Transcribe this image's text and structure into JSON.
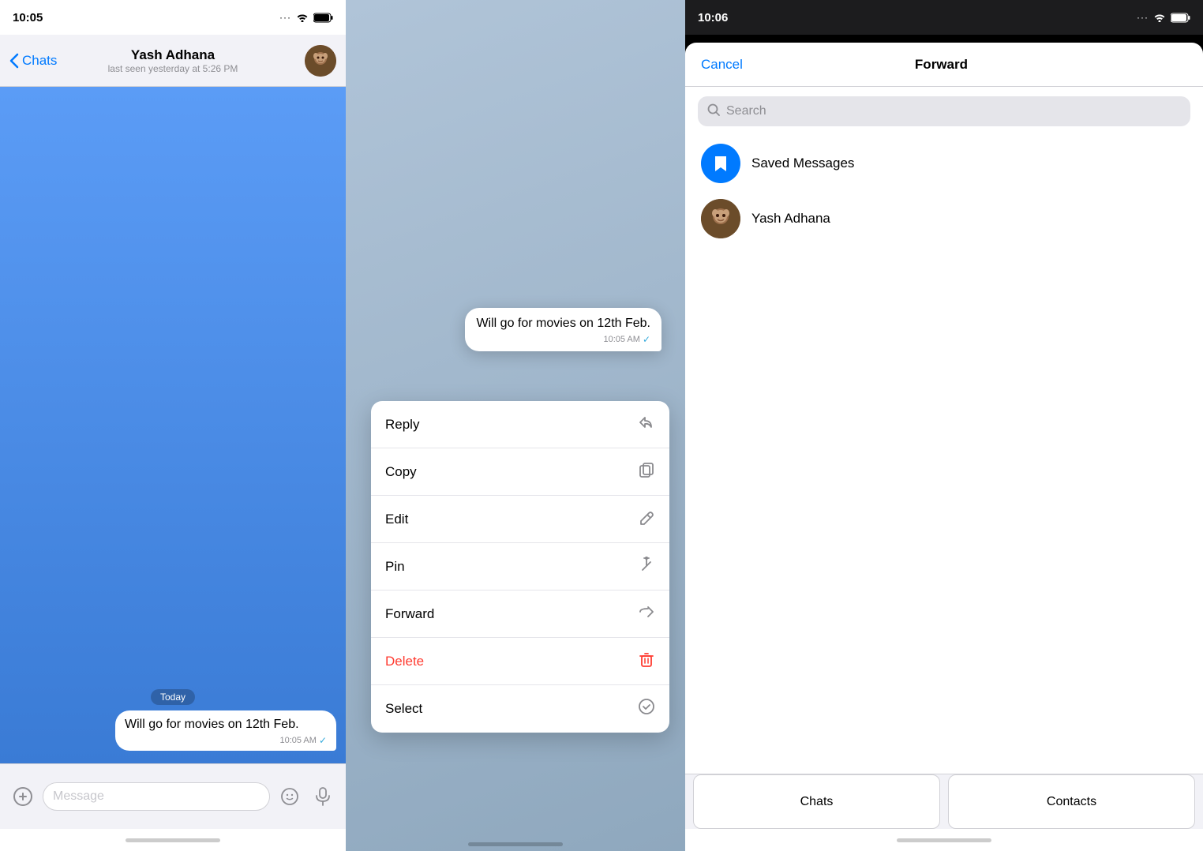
{
  "panel1": {
    "status_time": "10:05",
    "nav_name": "Yash Adhana",
    "nav_status": "last seen yesterday at 5:26 PM",
    "back_label": "Chats",
    "date_label": "Today",
    "message_text": "Will go for movies on 12th Feb.",
    "message_time": "10:05 AM",
    "input_placeholder": "Message"
  },
  "panel2": {
    "message_text": "Will go for movies on 12th Feb.",
    "message_time": "10:05 AM",
    "menu_items": [
      {
        "label": "Reply",
        "icon": "↩"
      },
      {
        "label": "Copy",
        "icon": "⧉"
      },
      {
        "label": "Edit",
        "icon": "✏"
      },
      {
        "label": "Pin",
        "icon": "📌"
      },
      {
        "label": "Forward",
        "icon": "➦"
      },
      {
        "label": "Delete",
        "icon": "🗑",
        "danger": true
      },
      {
        "label": "Select",
        "icon": "✓"
      }
    ]
  },
  "panel3": {
    "status_time": "10:06",
    "cancel_label": "Cancel",
    "title": "Forward",
    "search_placeholder": "Search",
    "contacts": [
      {
        "name": "Saved Messages",
        "type": "saved"
      },
      {
        "name": "Yash Adhana",
        "type": "user"
      }
    ],
    "tab_chats": "Chats",
    "tab_contacts": "Contacts"
  }
}
